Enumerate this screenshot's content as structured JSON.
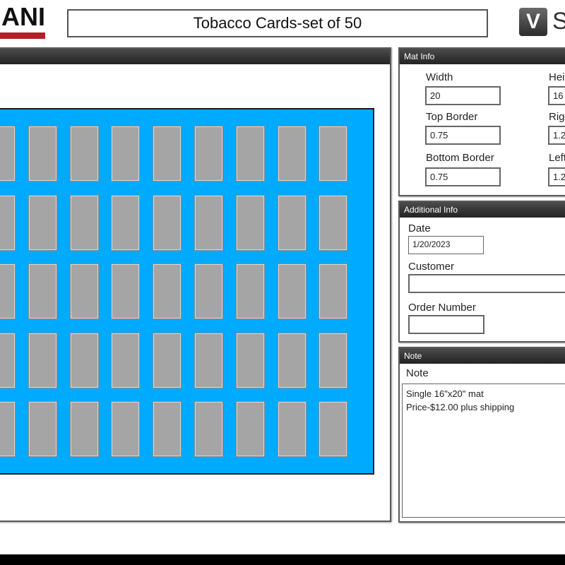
{
  "logo": {
    "text": "ANI"
  },
  "header": {
    "title": "Tobacco Cards-set of 50",
    "brand_mark": "V",
    "brand_text": "S"
  },
  "mat": {
    "color": "#00aaff",
    "opening_color": "#a5a5a5",
    "rows": 5,
    "columns": 9
  },
  "mat_info": {
    "title": "Mat Info",
    "width_label": "Width",
    "width_value": "20",
    "height_label": "Hei",
    "height_value": "16",
    "top_border_label": "Top Border",
    "top_border_value": "0.75",
    "right_border_label": "Rig",
    "right_border_value": "1.2",
    "bottom_border_label": "Bottom Border",
    "bottom_border_value": "0.75",
    "left_border_label": "Left",
    "left_border_value": "1.2"
  },
  "additional_info": {
    "title": "Additional Info",
    "date_label": "Date",
    "date_value": "1/20/2023",
    "customer_label": "Customer",
    "customer_value": "",
    "order_number_label": "Order Number",
    "order_number_value": ""
  },
  "note": {
    "title": "Note",
    "label": "Note",
    "line1": "Single 16\"x20\" mat",
    "line2": "Price-$12.00 plus shipping"
  }
}
